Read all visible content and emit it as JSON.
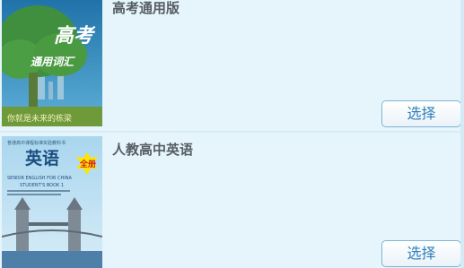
{
  "books": [
    {
      "title": "高考通用版",
      "select_label": "选择",
      "cover": {
        "main_text": "高考",
        "sub_text": "通用词汇",
        "footer_text": "你就是未来的栋梁",
        "bg_color": "#2a83b3",
        "tree_color": "#3a8a3a"
      }
    },
    {
      "title": "人教高中英语",
      "select_label": "选择",
      "cover": {
        "series_text": "普通高中课程标准实验教科书",
        "main_text": "英语",
        "badge_text": "全册",
        "sub_text": "SENIOR ENGLISH FOR CHINA",
        "sub_text2": "STUDENT'S BOOK 1",
        "bg_color": "#8fc6e4",
        "badge_color": "#ffe400"
      }
    }
  ]
}
